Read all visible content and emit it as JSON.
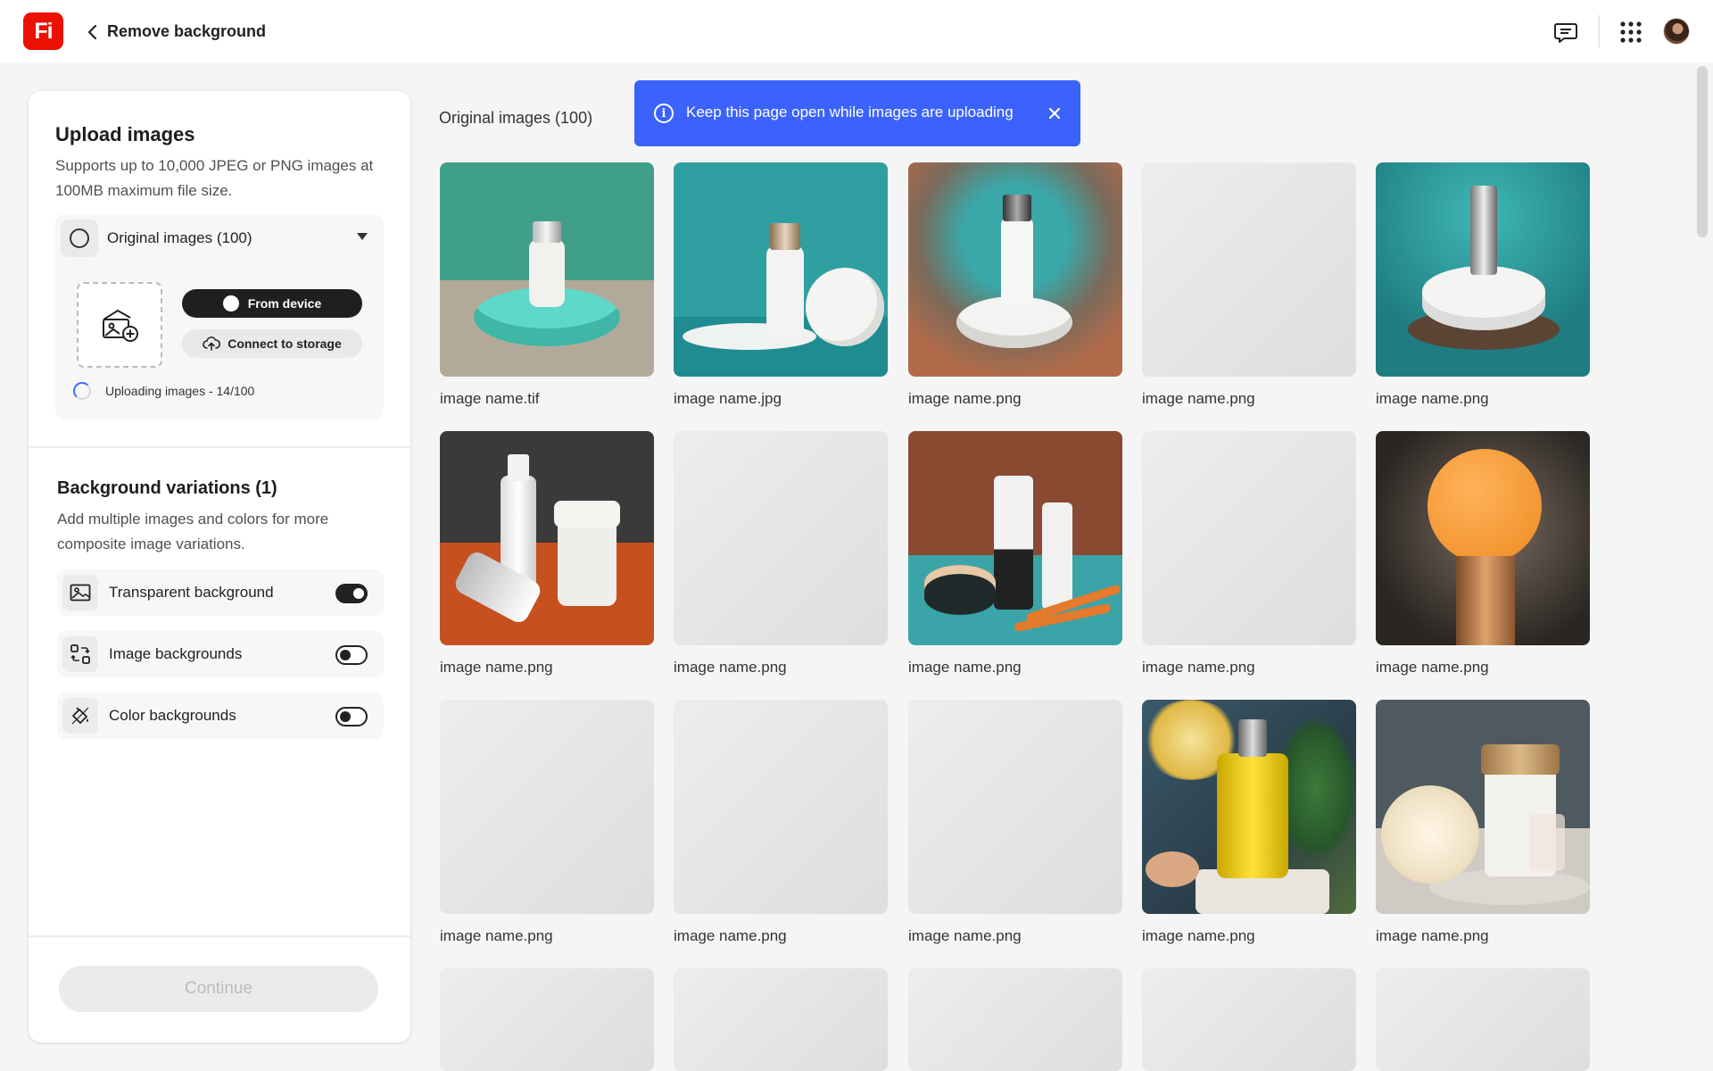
{
  "header": {
    "title": "Remove background",
    "logo_text": "Fi",
    "icons": [
      "chat-icon",
      "app-grid-icon"
    ]
  },
  "upload": {
    "title": "Upload images",
    "description": "Supports up to 10,000 JPEG or PNG images at 100MB maximum file size.",
    "source_label": "Original images (100)",
    "from_device_label": "From device",
    "connect_storage_label": "Connect to storage",
    "status": "Uploading images - 14/100",
    "progress": 0.14
  },
  "background": {
    "title": "Background variations (1)",
    "description": "Add multiple images and colors for more composite image variations.",
    "options": [
      {
        "label": "Transparent background",
        "icon": "image-icon",
        "enabled": true
      },
      {
        "label": "Image backgrounds",
        "icon": "image-backgrounds-icon",
        "enabled": false
      },
      {
        "label": "Color backgrounds",
        "icon": "paint-bucket-icon",
        "enabled": false
      }
    ]
  },
  "continue_label": "Continue",
  "grid": {
    "title": "Original images (100)",
    "toast": "Keep this page open while images are uploading",
    "items": [
      {
        "name": "image name.tif",
        "scene": "teal-podium"
      },
      {
        "name": "image name.jpg",
        "scene": "teal-bottle-lid"
      },
      {
        "name": "image name.png",
        "scene": "orange-speckle"
      },
      {
        "name": "image name.png",
        "scene": "placeholder"
      },
      {
        "name": "image name.png",
        "scene": "teal-jar"
      },
      {
        "name": "image name.png",
        "scene": "orange-bottles"
      },
      {
        "name": "image name.png",
        "scene": "placeholder"
      },
      {
        "name": "image name.png",
        "scene": "cosmetics-set"
      },
      {
        "name": "image name.png",
        "scene": "placeholder"
      },
      {
        "name": "image name.png",
        "scene": "orange-disc"
      },
      {
        "name": "image name.png",
        "scene": "placeholder"
      },
      {
        "name": "image name.png",
        "scene": "placeholder"
      },
      {
        "name": "image name.png",
        "scene": "placeholder"
      },
      {
        "name": "image name.png",
        "scene": "yellow-oil"
      },
      {
        "name": "image name.png",
        "scene": "cream-jar-flower"
      },
      {
        "name": "",
        "scene": "placeholder"
      },
      {
        "name": "",
        "scene": "placeholder"
      },
      {
        "name": "",
        "scene": "placeholder"
      },
      {
        "name": "",
        "scene": "placeholder"
      },
      {
        "name": "",
        "scene": "placeholder"
      }
    ]
  },
  "colors": {
    "brand": "#eb1000",
    "toast": "#3b63fb",
    "progress": "#3d6bff"
  }
}
